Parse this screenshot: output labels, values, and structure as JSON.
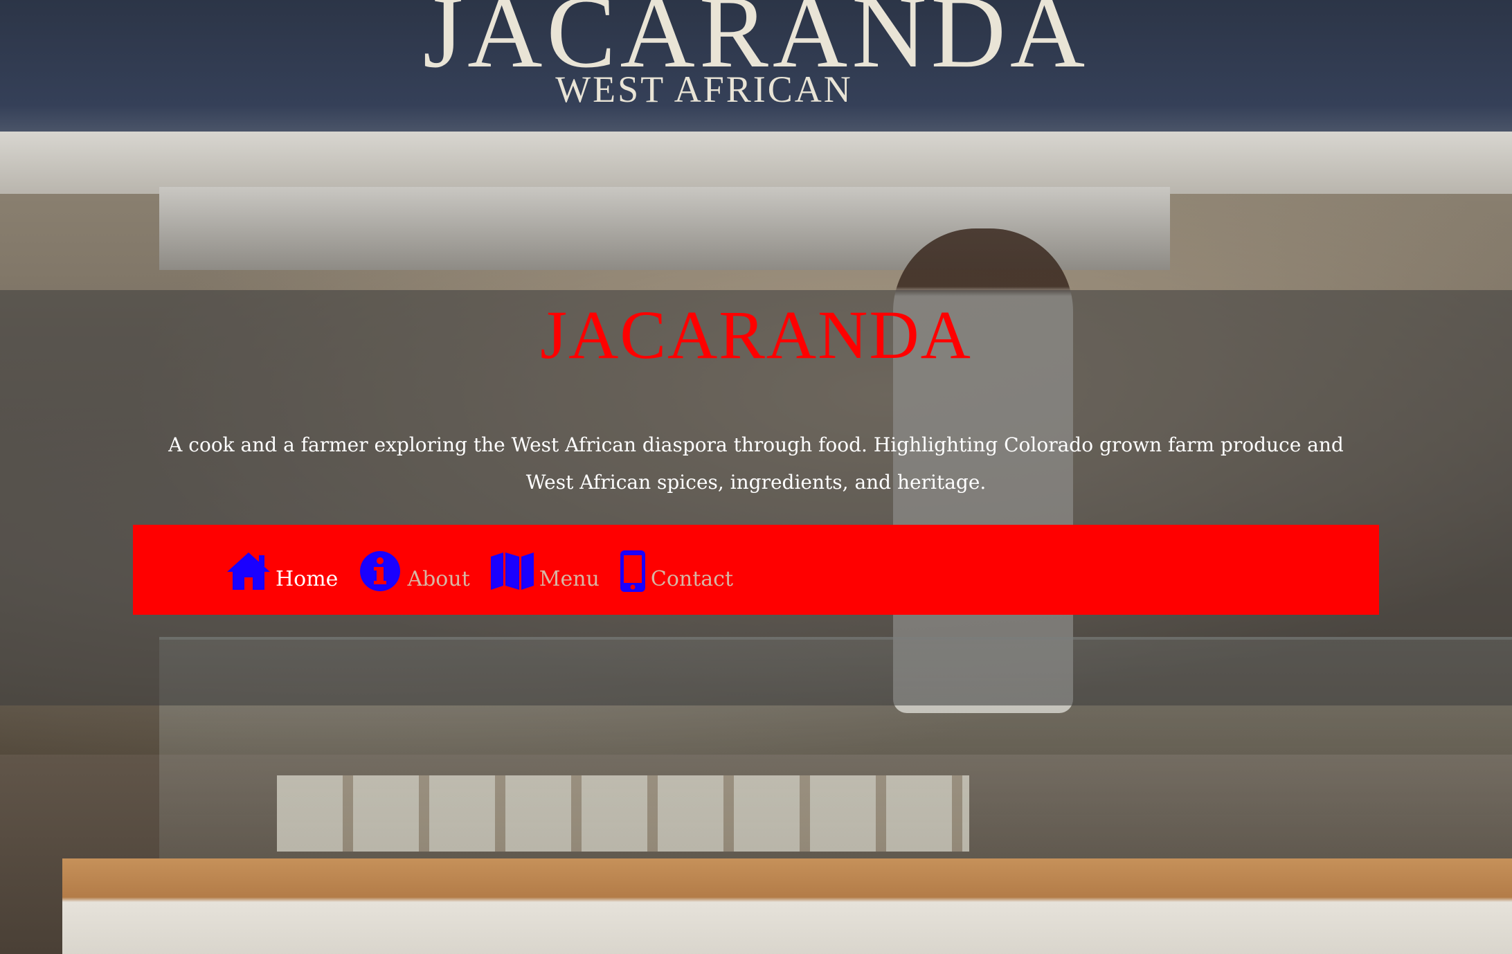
{
  "sign": {
    "name": "JACARANDA",
    "subtitle": "WEST AFRICAN"
  },
  "header": {
    "title": "JACARANDA",
    "tagline": "A cook and a farmer exploring the West African diaspora through food. Highlighting Colorado grown farm produce and West African spices, ingredients, and heritage."
  },
  "nav": {
    "items": [
      {
        "label": "Home",
        "icon": "home-icon",
        "active": true
      },
      {
        "label": "About",
        "icon": "info-circle-icon",
        "active": false
      },
      {
        "label": "Menu",
        "icon": "map-icon",
        "active": false
      },
      {
        "label": "Contact",
        "icon": "mobile-phone-icon",
        "active": false
      }
    ]
  },
  "colors": {
    "title": "#ff0000",
    "navbar_background": "#ff0000",
    "icon": "#1a00ff",
    "nav_active_text": "#ffffff",
    "nav_inactive_text": "#d7b6a4"
  }
}
